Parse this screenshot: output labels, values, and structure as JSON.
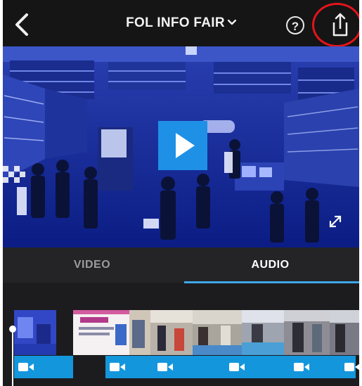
{
  "header": {
    "title": "FOL INFO  FAIR",
    "help_label": "?"
  },
  "tabs": [
    {
      "label": "VIDEO",
      "selected": false
    },
    {
      "label": "AUDIO",
      "selected": true
    }
  ],
  "icons": [
    "back-chevron-icon",
    "dropdown-chevron-icon",
    "help-icon",
    "share-icon",
    "play-icon",
    "expand-icon",
    "video-camera-icon"
  ],
  "colors": {
    "accent": "#1496dc",
    "tab_underline": "#3ea7e8",
    "annotation": "#e4141b"
  },
  "timeline": {
    "clip_count": 8,
    "clip_markers": 6
  }
}
